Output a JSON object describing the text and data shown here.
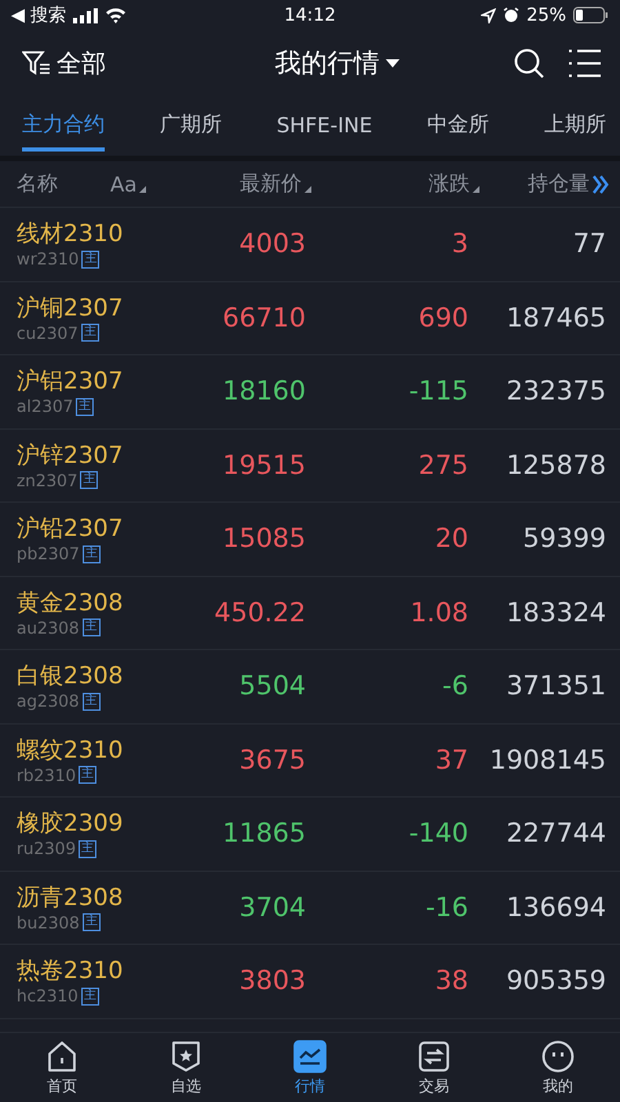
{
  "status_bar": {
    "back_label": "◀ 搜索",
    "time": "14:12",
    "battery": "25%"
  },
  "header": {
    "filter_label": "全部",
    "title": "我的行情"
  },
  "tabs": [
    {
      "label": "主力合约",
      "selected": true
    },
    {
      "label": "广期所",
      "selected": false
    },
    {
      "label": "SHFE-INE",
      "selected": false
    },
    {
      "label": "中金所",
      "selected": false
    },
    {
      "label": "上期所",
      "selected": false
    }
  ],
  "table": {
    "columns": [
      "名称",
      "Aa",
      "最新价",
      "涨跌",
      "持仓量"
    ],
    "rows": [
      {
        "name": "线材2310",
        "code": "wr2310",
        "badge": "主",
        "price": "4003",
        "change": "3",
        "open_interest": "77",
        "color": "#e8575d"
      },
      {
        "name": "沪铜2307",
        "code": "cu2307",
        "badge": "主",
        "price": "66710",
        "change": "690",
        "open_interest": "187465",
        "color": "#e8575d"
      },
      {
        "name": "沪铝2307",
        "code": "al2307",
        "badge": "主",
        "price": "18160",
        "change": "-115",
        "open_interest": "232375",
        "color": "#4fc46b"
      },
      {
        "name": "沪锌2307",
        "code": "zn2307",
        "badge": "主",
        "price": "19515",
        "change": "275",
        "open_interest": "125878",
        "color": "#e8575d"
      },
      {
        "name": "沪铅2307",
        "code": "pb2307",
        "badge": "主",
        "price": "15085",
        "change": "20",
        "open_interest": "59399",
        "color": "#e8575d"
      },
      {
        "name": "黄金2308",
        "code": "au2308",
        "badge": "主",
        "price": "450.22",
        "change": "1.08",
        "open_interest": "183324",
        "color": "#e8575d"
      },
      {
        "name": "白银2308",
        "code": "ag2308",
        "badge": "主",
        "price": "5504",
        "change": "-6",
        "open_interest": "371351",
        "color": "#4fc46b"
      },
      {
        "name": "螺纹2310",
        "code": "rb2310",
        "badge": "主",
        "price": "3675",
        "change": "37",
        "open_interest": "1908145",
        "color": "#e8575d"
      },
      {
        "name": "橡胶2309",
        "code": "ru2309",
        "badge": "主",
        "price": "11865",
        "change": "-140",
        "open_interest": "227744",
        "color": "#4fc46b"
      },
      {
        "name": "沥青2308",
        "code": "bu2308",
        "badge": "主",
        "price": "3704",
        "change": "-16",
        "open_interest": "136694",
        "color": "#4fc46b"
      },
      {
        "name": "热卷2310",
        "code": "hc2310",
        "badge": "主",
        "price": "3803",
        "change": "38",
        "open_interest": "905359",
        "color": "#e8575d"
      }
    ]
  },
  "bottom_nav": [
    {
      "label": "首页",
      "selected": false
    },
    {
      "label": "自选",
      "selected": false
    },
    {
      "label": "行情",
      "selected": true
    },
    {
      "label": "交易",
      "selected": false
    },
    {
      "label": "我的",
      "selected": false
    }
  ]
}
